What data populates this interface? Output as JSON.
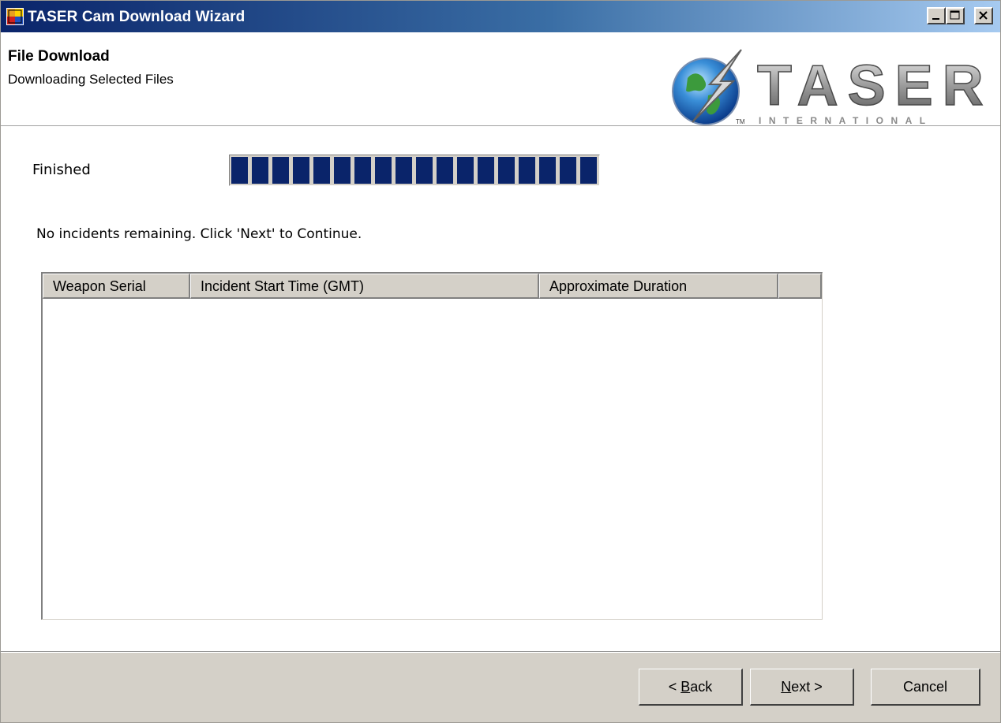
{
  "window": {
    "title": "TASER Cam Download Wizard",
    "controls": [
      "minimize",
      "maximize",
      "close"
    ]
  },
  "header": {
    "title": "File Download",
    "subtitle": "Downloading Selected Files",
    "logo": {
      "word": "TASER",
      "tagline": "INTERNATIONAL",
      "mark": "TM"
    }
  },
  "status": {
    "label": "Finished",
    "progress_fraction": 1.0
  },
  "message": "No incidents remaining. Click 'Next' to Continue.",
  "table": {
    "columns": [
      "Weapon Serial",
      "Incident Start Time (GMT)",
      "Approximate Duration",
      ""
    ],
    "rows": []
  },
  "buttons": {
    "back": {
      "prefix": "< ",
      "mnemonic": "B",
      "rest": "ack"
    },
    "next": {
      "prefix": "",
      "mnemonic": "N",
      "rest": "ext >"
    },
    "cancel": "Cancel"
  },
  "colors": {
    "progress_block": "#0a246a",
    "face": "#d4d0c8",
    "titlebar_start": "#0a246a",
    "titlebar_end": "#a6caf0"
  }
}
